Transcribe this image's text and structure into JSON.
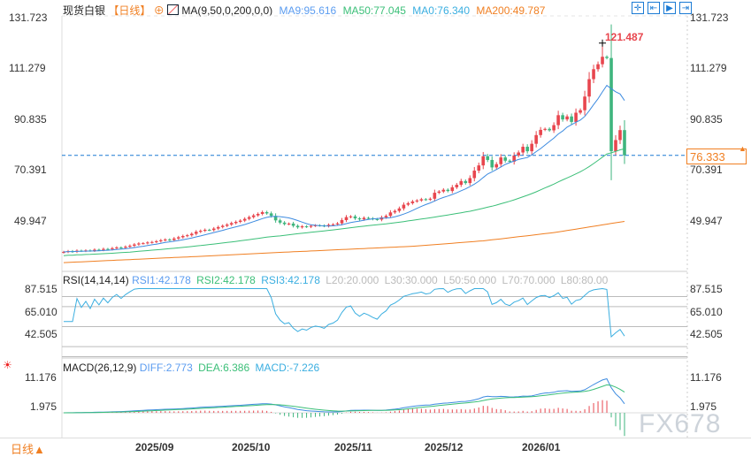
{
  "header": {
    "symbol": "现货白银",
    "period": "【日线】",
    "indicator": "MA(9,50,0,200,0,0)",
    "ma9": "MA9:95.616",
    "ma50": "MA50:77.045",
    "ma0": "MA0:76.340",
    "ma200": "MA200:49.787"
  },
  "rsi_header": {
    "name": "RSI(14,14,14)",
    "rsi1": "RSI1:42.178",
    "rsi2": "RSI2:42.178",
    "rsi3": "RSI3:42.178",
    "l20": "L20:20.000",
    "l30": "L30:30.000",
    "l50": "L50:50.000",
    "l70": "L70:70.000",
    "l80": "L80:80.00"
  },
  "macd_header": {
    "name": "MACD(26,12,9)",
    "diff": "DIFF:2.773",
    "dea": "DEA:6.386",
    "macd": "MACD:-7.226"
  },
  "period_button": "日线▲",
  "watermark": "FX678",
  "toolbar_icons": [
    "crosshair-icon",
    "zoom-start-icon",
    "play-icon",
    "go-end-icon"
  ],
  "colors": {
    "up": "#e8464e",
    "down": "#3fb57e",
    "ma9": "#3d8be0",
    "ma50": "#3bbf78",
    "ma200": "#f07f22",
    "rsi": "#3aaee0",
    "diff": "#3d8be0",
    "dea": "#3bbf78",
    "price_line": "#1a7ad4"
  },
  "chart_data": {
    "type": "candlestick",
    "y_ticks": [
      "131.723",
      "111.279",
      "90.835",
      "70.391",
      "49.947"
    ],
    "ylim": [
      32,
      135
    ],
    "x_ticks": [
      "2025/09",
      "2025/10",
      "2025/11",
      "2025/12",
      "2026/01"
    ],
    "max_label": "121.487",
    "current_price": "76.333",
    "closes": [
      37.5,
      37.8,
      37.6,
      38.0,
      37.9,
      38.1,
      38.0,
      38.4,
      38.3,
      38.7,
      38.6,
      39.0,
      39.3,
      39.2,
      39.6,
      40.0,
      40.5,
      40.9,
      41.0,
      41.3,
      41.5,
      41.8,
      42.2,
      42.5,
      42.3,
      42.9,
      43.4,
      43.9,
      44.2,
      44.8,
      45.6,
      46.0,
      46.4,
      46.3,
      46.9,
      47.5,
      48.0,
      48.5,
      49.1,
      49.6,
      50.1,
      50.8,
      51.5,
      52.2,
      52.8,
      53.5,
      53.0,
      52.0,
      50.2,
      49.3,
      48.7,
      48.9,
      48.0,
      47.4,
      47.8,
      47.6,
      48.0,
      48.2,
      48.1,
      47.9,
      48.4,
      48.6,
      49.0,
      50.3,
      51.5,
      51.8,
      51.0,
      50.6,
      51.2,
      51.0,
      50.7,
      50.5,
      51.4,
      52.0,
      53.4,
      54.0,
      55.0,
      56.5,
      57.1,
      57.8,
      58.2,
      58.7,
      58.5,
      58.9,
      61.3,
      61.8,
      62.5,
      62.0,
      63.5,
      64.5,
      66.0,
      65.2,
      67.2,
      70.2,
      72.3,
      76.0,
      74.5,
      71.5,
      72.8,
      75.5,
      74.2,
      73.8,
      76.3,
      77.5,
      79.8,
      78.0,
      81.0,
      84.5,
      86.6,
      87.0,
      86.4,
      88.5,
      92.5,
      90.8,
      92.0,
      89.8,
      93.5,
      94.5,
      100.0,
      107.0,
      111.0,
      113.0,
      116.0,
      115.5,
      78.0,
      82.5,
      86.5,
      76.333
    ],
    "ma200_samples": [
      33.2,
      34.5,
      35.8,
      37.2,
      38.5,
      39.8,
      42.0,
      45.3,
      49.787
    ],
    "rsi": {
      "y_ticks": [
        "87.515",
        "65.010",
        "42.505"
      ],
      "ylim": [
        20,
        87.515
      ],
      "levels": [
        20,
        30,
        50,
        70,
        80
      ]
    },
    "macd": {
      "y_ticks": [
        "11.176",
        "1.975"
      ]
    }
  }
}
